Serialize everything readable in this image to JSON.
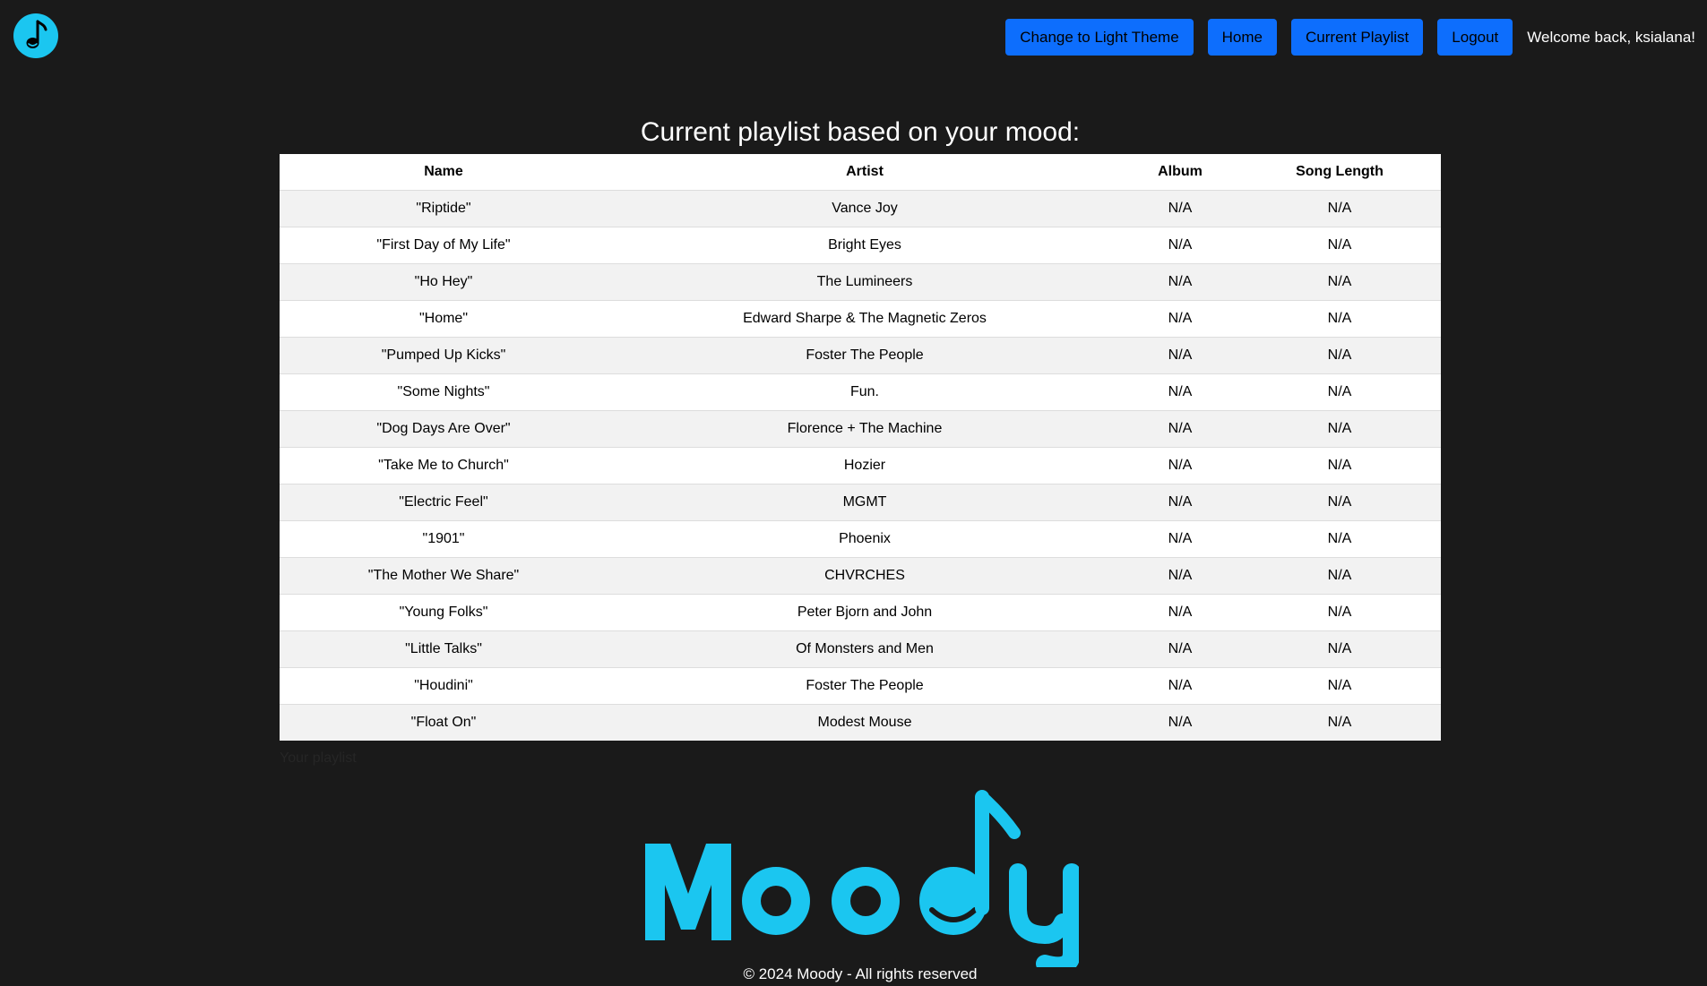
{
  "header": {
    "logo_icon": "music-note-icon",
    "buttons": {
      "theme": "Change to Light Theme",
      "home": "Home",
      "playlist": "Current Playlist",
      "logout": "Logout"
    },
    "welcome": "Welcome back, ksialana!"
  },
  "colors": {
    "background": "#1a1a1a",
    "accent": "#0d6efd",
    "brand": "#1bc6f0"
  },
  "main": {
    "title": "Current playlist based on your mood:",
    "table": {
      "headers": [
        "Name",
        "Artist",
        "Album",
        "Song Length"
      ],
      "rows": [
        [
          "\"Riptide\"",
          "Vance Joy",
          "N/A",
          "N/A"
        ],
        [
          "\"First Day of My Life\"",
          "Bright Eyes",
          "N/A",
          "N/A"
        ],
        [
          "\"Ho Hey\"",
          "The Lumineers",
          "N/A",
          "N/A"
        ],
        [
          "\"Home\"",
          "Edward Sharpe & The Magnetic Zeros",
          "N/A",
          "N/A"
        ],
        [
          "\"Pumped Up Kicks\"",
          "Foster The People",
          "N/A",
          "N/A"
        ],
        [
          "\"Some Nights\"",
          "Fun.",
          "N/A",
          "N/A"
        ],
        [
          "\"Dog Days Are Over\"",
          "Florence + The Machine",
          "N/A",
          "N/A"
        ],
        [
          "\"Take Me to Church\"",
          "Hozier",
          "N/A",
          "N/A"
        ],
        [
          "\"Electric Feel\"",
          "MGMT",
          "N/A",
          "N/A"
        ],
        [
          "\"1901\"",
          "Phoenix",
          "N/A",
          "N/A"
        ],
        [
          "\"The Mother We Share\"",
          "CHVRCHES",
          "N/A",
          "N/A"
        ],
        [
          "\"Young Folks\"",
          "Peter Bjorn and John",
          "N/A",
          "N/A"
        ],
        [
          "\"Little Talks\"",
          "Of Monsters and Men",
          "N/A",
          "N/A"
        ],
        [
          "\"Houdini\"",
          "Foster The People",
          "N/A",
          "N/A"
        ],
        [
          "\"Float On\"",
          "Modest Mouse",
          "N/A",
          "N/A"
        ]
      ]
    },
    "caption": "Your playlist"
  },
  "footer": {
    "brand_name": "Moody",
    "copyright": "© 2024 Moody - All rights reserved"
  }
}
